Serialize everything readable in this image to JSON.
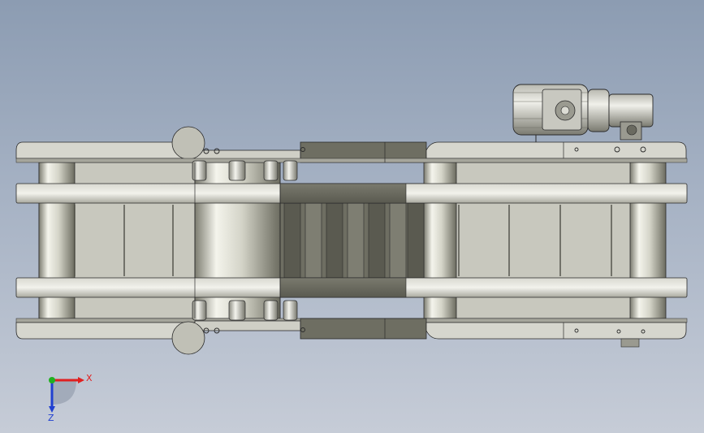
{
  "triad": {
    "x_label": "X",
    "z_label": "Z",
    "x_color": "#e02020",
    "y_color": "#20b020",
    "z_color": "#2040d0"
  },
  "colors": {
    "background_top": "#8c9cb2",
    "background_bottom": "#c6ccd7",
    "metal_light": "#e6e6df",
    "metal_mid": "#c2c2b8",
    "metal_dark": "#6a6a5e",
    "edge": "#2a2a2a"
  }
}
